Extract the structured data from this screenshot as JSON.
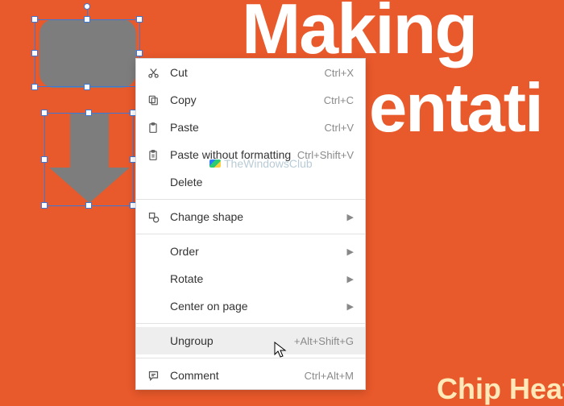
{
  "slide": {
    "title_line1": "Making",
    "title_line2": "entati",
    "title_stick": "<",
    "subtitle": "Chip Heatl"
  },
  "watermark": "TheWindowsClub",
  "menu": {
    "cut": {
      "label": "Cut",
      "shortcut": "Ctrl+X"
    },
    "copy": {
      "label": "Copy",
      "shortcut": "Ctrl+C"
    },
    "paste": {
      "label": "Paste",
      "shortcut": "Ctrl+V"
    },
    "paste_plain": {
      "label": "Paste without formatting",
      "shortcut": "Ctrl+Shift+V"
    },
    "delete": {
      "label": "Delete"
    },
    "change_shape": {
      "label": "Change shape"
    },
    "order": {
      "label": "Order"
    },
    "rotate": {
      "label": "Rotate"
    },
    "center": {
      "label": "Center on page"
    },
    "ungroup": {
      "label": "Ungroup",
      "shortcut": "+Alt+Shift+G"
    },
    "comment": {
      "label": "Comment",
      "shortcut": "Ctrl+Alt+M"
    }
  }
}
